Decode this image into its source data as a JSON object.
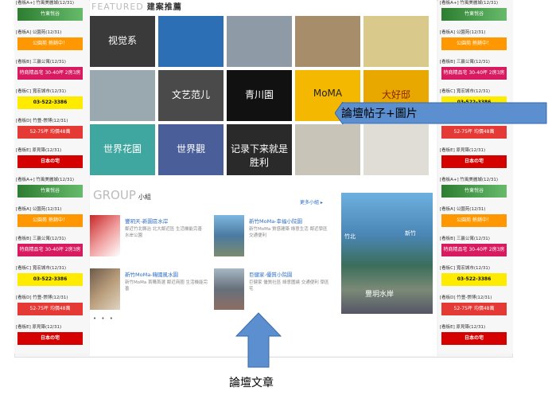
{
  "ads": [
    {
      "label": "[看板A+] 竹風美麗城(12/31)",
      "banner": "竹東悅谷",
      "style": "b-fam"
    },
    {
      "label": "[看板A] 公園苑(12/31)",
      "banner": "公園苑 熱銷中！",
      "style": "b-orange"
    },
    {
      "label": "[看板B] 三贏公寓(12/31)",
      "banner": "特商精品宅 30-40坪 2房3房",
      "style": "b-pink"
    },
    {
      "label": "[看板C] 寬宏城市(12/31)",
      "banner": "03-522-3386",
      "style": "b-yellow"
    },
    {
      "label": "[看板D] 竹豊-崇博(12/31)",
      "banner": "52-75坪 均價48萬",
      "style": "b-red"
    },
    {
      "label": "[看板E] 原見築(12/31)",
      "banner": "日本の宅",
      "style": "b-japan"
    }
  ],
  "featured": {
    "en": "FEATURED",
    "zh": "建案推薦"
  },
  "group": {
    "en": "GROUP",
    "zh": "小組",
    "more": "更多小組 ▸"
  },
  "tiles": [
    {
      "text": "视觉系",
      "bg": "#3a3a3a",
      "fg": "#ffffff"
    },
    {
      "text": "",
      "bg": "#2d6fb5",
      "fg": "#ffffff"
    },
    {
      "text": "",
      "bg": "#8e9aa6",
      "fg": "#ffffff"
    },
    {
      "text": "",
      "bg": "#a88d6b",
      "fg": "#ffffff"
    },
    {
      "text": "",
      "bg": "#d9c98a",
      "fg": "#ffffff"
    },
    {
      "text": "",
      "bg": "#9aa8b0",
      "fg": "#ffffff"
    },
    {
      "text": "文艺范儿",
      "bg": "#4a4a4a",
      "fg": "#ffffff"
    },
    {
      "text": "青川園",
      "bg": "#111111",
      "fg": "#ffffff"
    },
    {
      "text": "MoMA",
      "bg": "#f5b800",
      "fg": "#222222"
    },
    {
      "text": "大好邸",
      "bg": "#e8a800",
      "fg": "#8b2500"
    },
    {
      "text": "世界花園",
      "bg": "#3fa7a0",
      "fg": "#ffffff"
    },
    {
      "text": "世界觀",
      "bg": "#4a5f9a",
      "fg": "#ffffff"
    },
    {
      "text": "记录下来就是胜利",
      "bg": "#2a2a2a",
      "fg": "#ffffff"
    },
    {
      "text": "",
      "bg": "#c9c4b8",
      "fg": "#ffffff"
    },
    {
      "text": "",
      "bg": "#e0ddd6",
      "fg": "#ffffff"
    }
  ],
  "posts": [
    {
      "title": "豐玥天-新園區水岸",
      "desc": "鄰近竹北縣治 北大鄰近區 生活機能完善 水岸公園"
    },
    {
      "title": "新竹MoMa-幸福小院園",
      "desc": "新竹MoMa 質感建築 綠意生活 鄰近學區 交通便利"
    },
    {
      "title": "新竹MoMa-韓國風水園",
      "desc": "新竹MoMa 首購首選 鄰近商圈 生活機能完善"
    },
    {
      "title": "巨健家-優質小院園",
      "desc": "巨健家 優質社區 綠意圍繞 交通便利 學區宅"
    }
  ],
  "pager": "• • •",
  "bigphoto": {
    "cap1": "竹北",
    "cap2": "新竹",
    "cap3": "豐玥水岸"
  },
  "callout": "論壇帖子+圖片",
  "caption": "論壇文章"
}
